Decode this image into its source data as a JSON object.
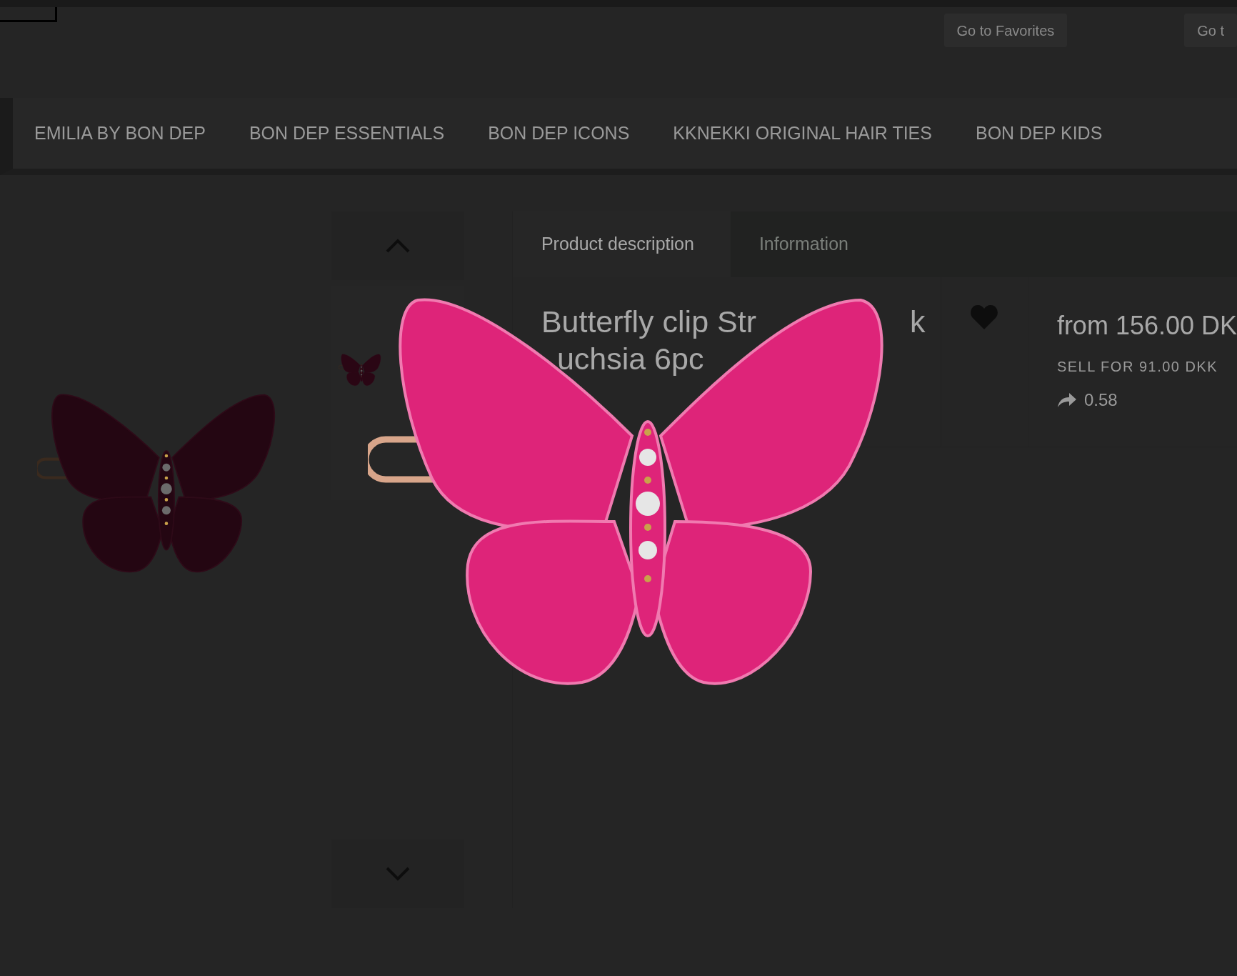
{
  "header": {
    "buttons": [
      "Go to Favorites",
      "Go t"
    ]
  },
  "nav": {
    "items": [
      "EMILIA BY BON DEP",
      "BON DEP ESSENTIALS",
      "BON DEP ICONS",
      "KKNEKKI ORIGINAL HAIR TIES",
      "BON DEP KIDS"
    ]
  },
  "tabs": [
    {
      "label": "Product description",
      "selected": true
    },
    {
      "label": "Information",
      "selected": false
    }
  ],
  "product": {
    "title_line_1_parts": [
      "Butterfly clip Str",
      "k"
    ],
    "title_line_2": "uchsia 6pc",
    "price": "from 156.00 DK",
    "sell_for": "SELL FOR 91.00 DKK",
    "factor": "0.58"
  }
}
